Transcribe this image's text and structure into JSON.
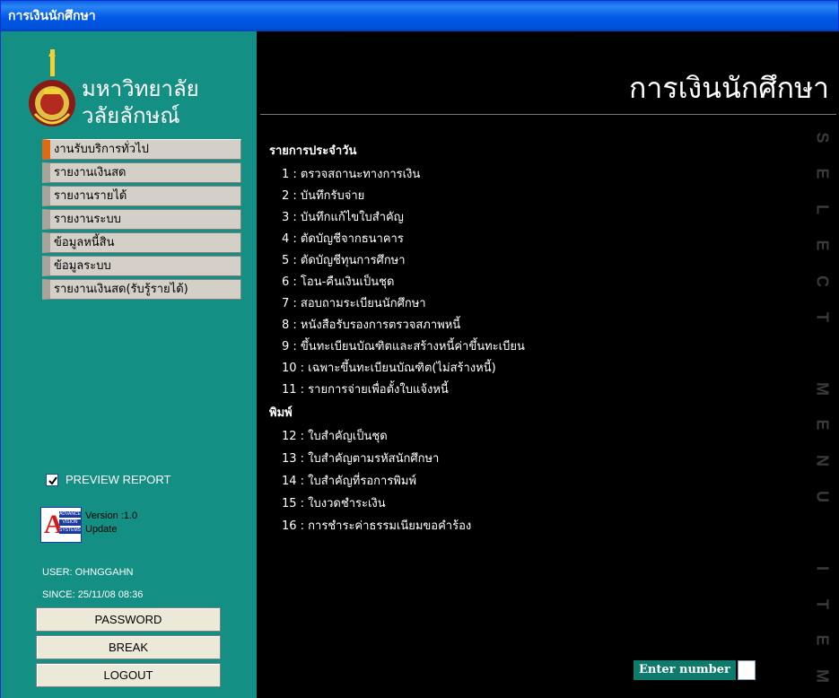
{
  "window": {
    "title": "การเงินนักศึกษา"
  },
  "logo": {
    "line1": "มหาวิทยาลัย",
    "line2": "วลัยลักษณ์"
  },
  "sidebar": {
    "items": [
      {
        "label": "งานรับบริการทั่วไป",
        "active": true
      },
      {
        "label": "รายงานเงินสด"
      },
      {
        "label": "รายงานรายได้"
      },
      {
        "label": "รายงานระบบ"
      },
      {
        "label": "ข้อมูลหนี้สิน"
      },
      {
        "label": "ข้อมูลระบบ"
      },
      {
        "label": "รายงานเงินสด(รับรู้รายได้)"
      }
    ],
    "preview_label": "PREVIEW REPORT",
    "preview_checked": true,
    "avs": {
      "bar1": "ADVANCE",
      "bar2": "VISION",
      "bar3": "SYSTEMS",
      "version": "Version :1.0",
      "update": "Update"
    },
    "user": "USER: OHNGGAHN",
    "since": "SINCE: 25/11/08 08:36",
    "buttons": {
      "password": "PASSWORD",
      "break": "BREAK",
      "logout": "LOGOUT"
    }
  },
  "main": {
    "title": "การเงินนักศึกษา",
    "sections": [
      {
        "heading": "รายการประจำวัน",
        "items": [
          "1 : ตรวจสถานะทางการเงิน",
          "2 : บันทึกรับจ่าย",
          "3 : บันทึกแก้ไขใบสำคัญ",
          "4 : ตัดบัญชีจากธนาคาร",
          "5 : ตัดบัญชีทุนการศึกษา",
          "6 : โอน-คืนเงินเป็นชุด",
          "7 : สอบถามระเบียนนักศึกษา",
          "8 : หนังสือรับรองการตรวจสภาพหนี้",
          "9 : ขึ้นทะเบียนบัณฑิตและสร้างหนี้ค่าขึ้นทะเบียน",
          "10 : เฉพาะขึ้นทะเบียนบัณฑิต(ไม่สร้างหนี้)",
          "11 : รายการจ่ายเพื่อตั้งใบแจ้งหนี้"
        ]
      },
      {
        "heading": "พิมพ์",
        "items": [
          "12 : ใบสำคัญเป็นชุด",
          "13 : ใบสำคัญตามรหัสนักศึกษา",
          "14 : ใบสำคัญที่รอการพิมพ์",
          "15 : ใบงวดชำระเงิน",
          "16 : การชำระค่าธรรมเนียมขอคำร้อง"
        ]
      }
    ],
    "vertical_letters": [
      "S",
      "E",
      "L",
      "E",
      "C",
      "T",
      "M",
      "E",
      "N",
      "U",
      "I",
      "T",
      "E",
      "M"
    ],
    "enter_label": "Enter number",
    "enter_value": ""
  }
}
